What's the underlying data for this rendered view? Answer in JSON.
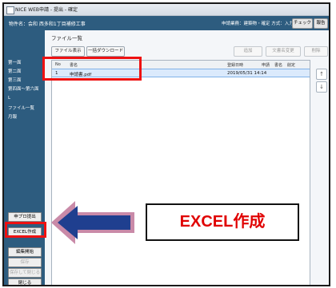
{
  "window": {
    "title": "NICE WEB申請 - 提出 - 確定"
  },
  "header": {
    "project": "物件名：会和 西多和1丁目補修工事",
    "status_info": "申請業務：建築物・確定 方式：入力",
    "check_label": "チェック",
    "report_label": "報告"
  },
  "sidebar": {
    "items": [
      "第一面",
      "第二面",
      "第三面",
      "第四面〜第六面",
      "L",
      "ファイル一覧",
      "月報"
    ],
    "buttons": {
      "apply_call": "申プロ提出",
      "excel": "EXCEL作成",
      "edit_start": "編集開始",
      "save": "保存",
      "save_close": "保存して閉じる",
      "close": "閉じる"
    }
  },
  "main": {
    "title": "ファイル一覧",
    "toolbar": {
      "file_display": "ファイル表示",
      "bulk_download": "一括ダウンロード",
      "add": "追加",
      "edit_doc": "文書名変更",
      "delete": "削除"
    },
    "columns": [
      "No",
      "書名",
      "登録日時",
      "申請",
      "書名",
      "削定"
    ],
    "rows": [
      {
        "no": "1",
        "name": "申請書.pdf",
        "date": "2019/05/31 14:14"
      }
    ],
    "scroll_up": "↑",
    "scroll_down": "↓"
  },
  "callout": {
    "text": "EXCEL作成"
  },
  "colors": {
    "sidebar": "#2d5c7f",
    "highlight": "#ee1111",
    "arrow_fill": "#1f3f8f",
    "arrow_border": "#c98aa8"
  }
}
